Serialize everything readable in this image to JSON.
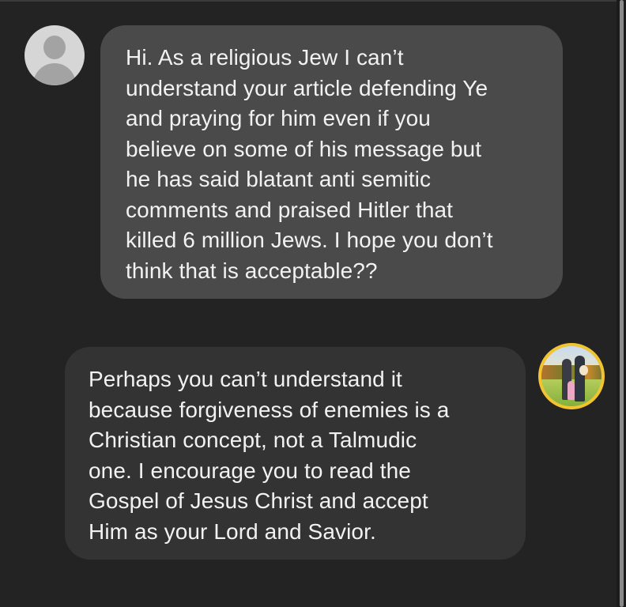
{
  "conversation": {
    "incoming_message": {
      "sender_avatar_icon": "default-person-avatar-icon",
      "lines": [
        "Hi. As a religious Jew I can’t",
        "understand your article defending Ye",
        "and praying for him even if you",
        "believe on some of his message but",
        "he has said blatant anti semitic",
        "comments and praised Hitler that",
        "killed 6 million Jews. I hope you don’t",
        "think that is acceptable??"
      ]
    },
    "outgoing_message": {
      "sender_avatar_icon": "family-photo-avatar",
      "avatar_ring_color": "#f4c430",
      "lines": [
        "Perhaps you can’t understand it",
        "because forgiveness of enemies is a",
        "Christian concept, not a Talmudic",
        "one. I encourage you to read the",
        "Gospel of Jesus Christ and accept",
        "Him as your Lord and Savior."
      ]
    }
  },
  "colors": {
    "background": "#232323",
    "incoming_bubble": "#4a4a4a",
    "outgoing_bubble": "#333333",
    "text": "#f2f2f2"
  }
}
